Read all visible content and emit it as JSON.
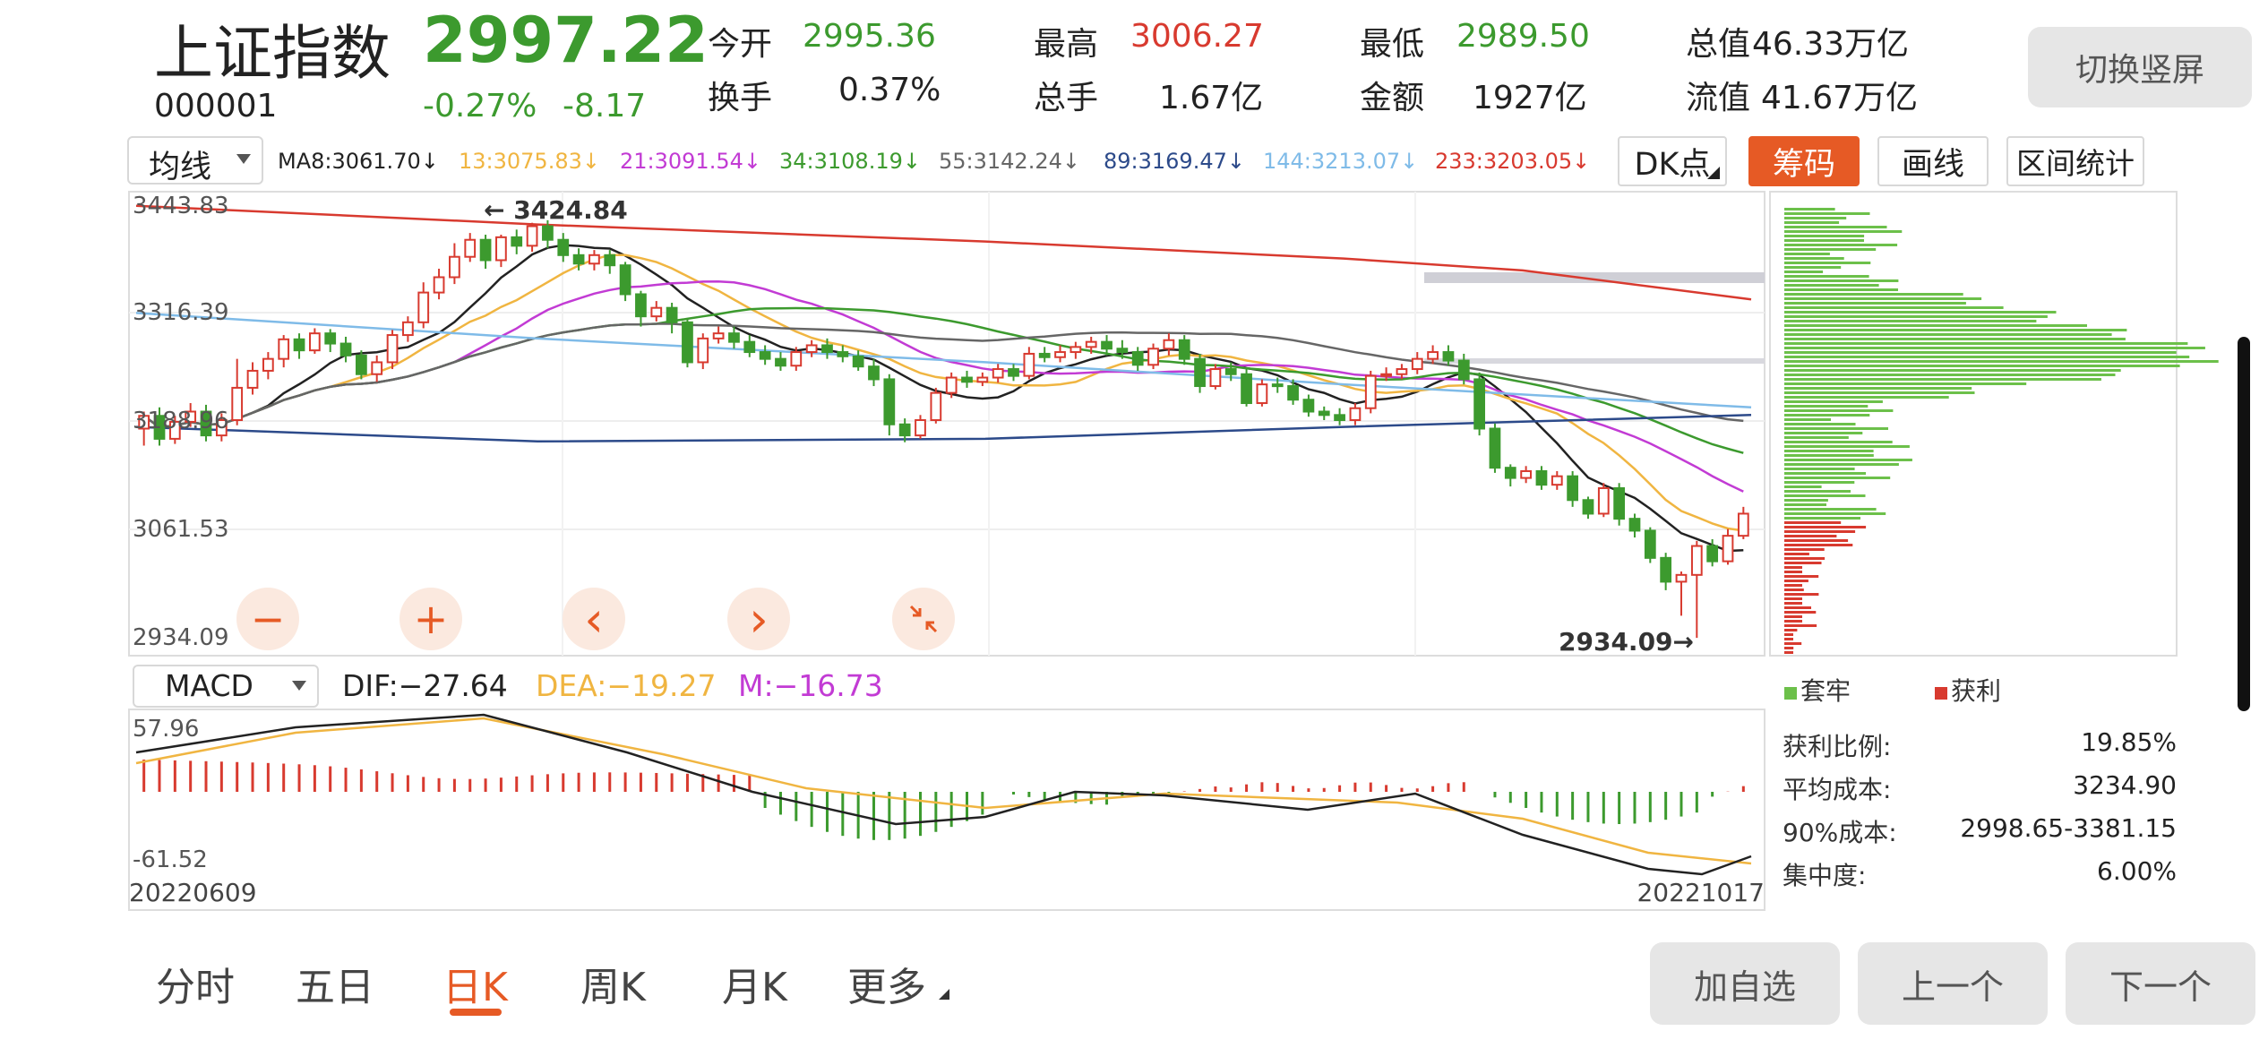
{
  "header": {
    "name": "上证指数",
    "code": "000001",
    "price": "2997.22",
    "change_pct": "-0.27%",
    "change": "-8.17",
    "stats": {
      "open": {
        "label": "今开",
        "value": "2995.36"
      },
      "high": {
        "label": "最高",
        "value": "3006.27"
      },
      "low": {
        "label": "最低",
        "value": "2989.50"
      },
      "total_value": {
        "label": "总值",
        "value": "46.33万亿"
      },
      "turnover": {
        "label": "换手",
        "value": "0.37%"
      },
      "volume": {
        "label": "总手",
        "value": "1.67亿"
      },
      "amount": {
        "label": "金额",
        "value": "1927亿"
      },
      "float_value": {
        "label": "流值",
        "value": "41.67万亿"
      }
    },
    "switch_button": "切换竖屏"
  },
  "toolbar": {
    "ma_select": "均线",
    "ma_items": [
      {
        "label": "MA8:3061.70↓",
        "color": "#222222"
      },
      {
        "label": "13:3075.83↓",
        "color": "#f0b541"
      },
      {
        "label": "21:3091.54↓",
        "color": "#c23bd4"
      },
      {
        "label": "34:3108.19↓",
        "color": "#3c9a2e"
      },
      {
        "label": "55:3142.24↓",
        "color": "#666666"
      },
      {
        "label": "89:3169.47↓",
        "color": "#2c4a8a"
      },
      {
        "label": "144:3213.07↓",
        "color": "#7fbbe8"
      },
      {
        "label": "233:3203.05↓",
        "color": "#d83a2f"
      }
    ],
    "dk_button": "DK点",
    "chips_button": "筹码",
    "draw_button": "画线",
    "range_button": "区间统计"
  },
  "chart_controls": {
    "zoom_out": "−",
    "zoom_in": "+",
    "prev": "‹",
    "next": "›",
    "collapse": "collapse"
  },
  "macd_bar": {
    "select": "MACD",
    "dif": "DIF:−27.64",
    "dea": "DEA:−19.27",
    "m": "M:−16.73"
  },
  "chips": {
    "legend_trapped": "套牢",
    "legend_profit": "获利",
    "rows": [
      {
        "label": "获利比例:",
        "value": "19.85%"
      },
      {
        "label": "平均成本:",
        "value": "3234.90"
      },
      {
        "label": "90%成本:",
        "value": "2998.65-3381.15"
      },
      {
        "label": "集中度:",
        "value": "6.00%"
      }
    ]
  },
  "bottom_tabs": [
    "分时",
    "五日",
    "日K",
    "周K",
    "月K",
    "更多"
  ],
  "active_tab": 2,
  "bottom_buttons": {
    "add": "加自选",
    "prev": "上一个",
    "next": "下一个"
  },
  "colors": {
    "up": "#d83a2f",
    "down": "#3c9a2e",
    "accent": "#e65a25"
  },
  "chart_data": [
    {
      "type": "candlestick",
      "title": "",
      "ylim": [
        2934.09,
        3443.83
      ],
      "y_ticks": [
        "3443.83",
        "3316.39",
        "3188.96",
        "3061.53",
        "2934.09"
      ],
      "annotations": {
        "max_label": "3424.84",
        "min_label": "2934.09"
      },
      "candles": [
        [
          3180,
          3195,
          3160,
          3200
        ],
        [
          3195,
          3168,
          3160,
          3205
        ],
        [
          3168,
          3188,
          3162,
          3195
        ],
        [
          3188,
          3200,
          3182,
          3210
        ],
        [
          3200,
          3172,
          3165,
          3208
        ],
        [
          3172,
          3190,
          3165,
          3198
        ],
        [
          3190,
          3228,
          3184,
          3262
        ],
        [
          3228,
          3248,
          3220,
          3258
        ],
        [
          3248,
          3262,
          3238,
          3270
        ],
        [
          3262,
          3285,
          3252,
          3290
        ],
        [
          3285,
          3272,
          3262,
          3292
        ],
        [
          3272,
          3292,
          3268,
          3298
        ],
        [
          3292,
          3280,
          3270,
          3297
        ],
        [
          3280,
          3266,
          3258,
          3288
        ],
        [
          3266,
          3244,
          3238,
          3272
        ],
        [
          3244,
          3258,
          3235,
          3266
        ],
        [
          3258,
          3290,
          3250,
          3296
        ],
        [
          3290,
          3305,
          3282,
          3312
        ],
        [
          3305,
          3340,
          3298,
          3352
        ],
        [
          3340,
          3358,
          3332,
          3368
        ],
        [
          3358,
          3382,
          3350,
          3398
        ],
        [
          3382,
          3402,
          3376,
          3410
        ],
        [
          3402,
          3378,
          3368,
          3408
        ],
        [
          3378,
          3405,
          3370,
          3408
        ],
        [
          3405,
          3395,
          3385,
          3414
        ],
        [
          3395,
          3418,
          3388,
          3422
        ],
        [
          3418,
          3402,
          3392,
          3425
        ],
        [
          3402,
          3384,
          3376,
          3410
        ],
        [
          3384,
          3374,
          3366,
          3392
        ],
        [
          3374,
          3384,
          3366,
          3390
        ],
        [
          3384,
          3372,
          3362,
          3390
        ],
        [
          3372,
          3338,
          3330,
          3376
        ],
        [
          3338,
          3312,
          3300,
          3342
        ],
        [
          3312,
          3322,
          3306,
          3330
        ],
        [
          3322,
          3305,
          3292,
          3328
        ],
        [
          3305,
          3258,
          3252,
          3310
        ],
        [
          3258,
          3286,
          3250,
          3292
        ],
        [
          3286,
          3292,
          3280,
          3300
        ],
        [
          3292,
          3282,
          3274,
          3300
        ],
        [
          3282,
          3270,
          3264,
          3290
        ],
        [
          3270,
          3262,
          3255,
          3278
        ],
        [
          3262,
          3254,
          3248,
          3270
        ],
        [
          3254,
          3270,
          3248,
          3276
        ],
        [
          3270,
          3278,
          3264,
          3284
        ],
        [
          3278,
          3270,
          3262,
          3286
        ],
        [
          3270,
          3265,
          3258,
          3278
        ],
        [
          3265,
          3253,
          3248,
          3272
        ],
        [
          3253,
          3238,
          3230,
          3262
        ],
        [
          3238,
          3185,
          3172,
          3244
        ],
        [
          3185,
          3172,
          3164,
          3192
        ],
        [
          3172,
          3190,
          3168,
          3196
        ],
        [
          3190,
          3222,
          3186,
          3228
        ],
        [
          3222,
          3240,
          3216,
          3246
        ],
        [
          3240,
          3235,
          3228,
          3248
        ],
        [
          3235,
          3240,
          3230,
          3246
        ],
        [
          3240,
          3250,
          3234,
          3256
        ],
        [
          3250,
          3242,
          3236,
          3256
        ],
        [
          3242,
          3268,
          3238,
          3276
        ],
        [
          3268,
          3264,
          3258,
          3276
        ],
        [
          3264,
          3270,
          3258,
          3278
        ],
        [
          3270,
          3276,
          3262,
          3282
        ],
        [
          3276,
          3282,
          3268,
          3288
        ],
        [
          3282,
          3274,
          3266,
          3290
        ],
        [
          3274,
          3270,
          3262,
          3284
        ],
        [
          3270,
          3255,
          3248,
          3276
        ],
        [
          3255,
          3274,
          3250,
          3280
        ],
        [
          3274,
          3284,
          3266,
          3292
        ],
        [
          3284,
          3262,
          3255,
          3290
        ],
        [
          3262,
          3230,
          3222,
          3268
        ],
        [
          3230,
          3250,
          3226,
          3256
        ],
        [
          3250,
          3244,
          3236,
          3258
        ],
        [
          3244,
          3210,
          3206,
          3252
        ],
        [
          3210,
          3232,
          3206,
          3238
        ],
        [
          3232,
          3230,
          3222,
          3240
        ],
        [
          3230,
          3214,
          3208,
          3238
        ],
        [
          3214,
          3200,
          3194,
          3220
        ],
        [
          3200,
          3196,
          3190,
          3206
        ],
        [
          3196,
          3190,
          3184,
          3204
        ],
        [
          3190,
          3204,
          3184,
          3210
        ],
        [
          3204,
          3242,
          3198,
          3248
        ],
        [
          3242,
          3244,
          3236,
          3252
        ],
        [
          3244,
          3250,
          3238,
          3256
        ],
        [
          3250,
          3262,
          3244,
          3270
        ],
        [
          3262,
          3270,
          3256,
          3278
        ],
        [
          3270,
          3260,
          3254,
          3278
        ],
        [
          3260,
          3238,
          3232,
          3268
        ],
        [
          3238,
          3180,
          3172,
          3246
        ],
        [
          3180,
          3134,
          3128,
          3186
        ],
        [
          3134,
          3122,
          3112,
          3138
        ],
        [
          3122,
          3130,
          3116,
          3136
        ],
        [
          3130,
          3114,
          3108,
          3136
        ],
        [
          3114,
          3124,
          3108,
          3130
        ],
        [
          3124,
          3096,
          3088,
          3130
        ],
        [
          3096,
          3080,
          3074,
          3100
        ],
        [
          3080,
          3110,
          3076,
          3116
        ],
        [
          3110,
          3074,
          3066,
          3116
        ],
        [
          3074,
          3060,
          3052,
          3080
        ],
        [
          3060,
          3028,
          3022,
          3064
        ],
        [
          3028,
          3000,
          2990,
          3034
        ],
        [
          3000,
          3008,
          2960,
          3012
        ],
        [
          3008,
          3042,
          2934,
          3048
        ],
        [
          3042,
          3024,
          3018,
          3050
        ],
        [
          3024,
          3054,
          3020,
          3062
        ],
        [
          3054,
          3080,
          3050,
          3088
        ]
      ]
    },
    {
      "type": "bar",
      "title": "MACD",
      "ylim": [
        -61.52,
        57.96
      ],
      "y_ticks": [
        "57.96",
        "-61.52"
      ],
      "x_labels": [
        "20220609",
        "20221017"
      ],
      "series": [
        {
          "name": "DIF",
          "values": [
            -27.64
          ]
        },
        {
          "name": "DEA",
          "values": [
            -19.27
          ]
        },
        {
          "name": "M",
          "values": [
            -16.73
          ]
        }
      ]
    }
  ]
}
